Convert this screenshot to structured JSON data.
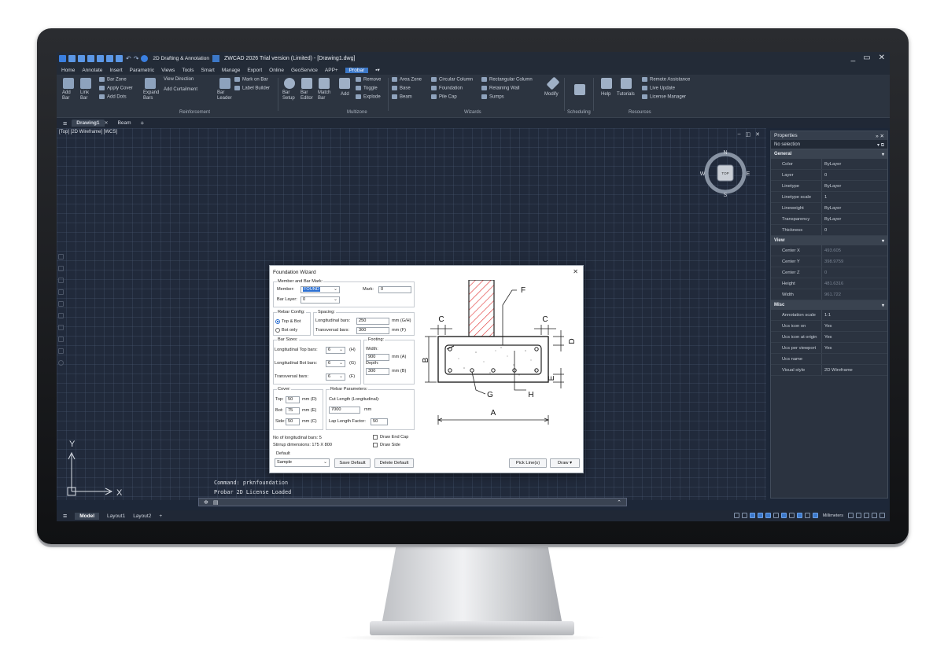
{
  "app": {
    "title": "ZWCAD 2026 Trial version (Limited) - [Drawing1.dwg]",
    "workspace": "2D Drafting & Annotation",
    "window_controls": [
      "_",
      "▭",
      "✕"
    ]
  },
  "menu": [
    "Home",
    "Annotate",
    "Insert",
    "Parametric",
    "Views",
    "Tools",
    "Smart",
    "Manage",
    "Export",
    "Online",
    "GeoService",
    "APP+",
    "Probar"
  ],
  "menu_active": "Probar",
  "ribbon": {
    "add_bar": "Add\nBar",
    "link_bar": "Link\nBar",
    "bar_zone": "Bar Zone",
    "apply_cover": "Apply Cover",
    "add_dots": "Add Dots",
    "expand_bars": "Expand\nBars",
    "view_direction": "View Direction",
    "add_curtailment": "Add Curtailment",
    "bar_leader": "Bar\nLeader",
    "mark_on_bar": "Mark on Bar",
    "label_builder": "Label Builder",
    "bar_setup": "Bar\nSetup",
    "bar_editor": "Bar\nEditor",
    "match_bar": "Match\nBar",
    "add": "Add",
    "remove": "Remove",
    "toggle": "Toggle",
    "explode": "Explode",
    "area_zone": "Area Zone",
    "base": "Base",
    "beam": "Beam",
    "circular_column": "Circular Column",
    "foundation": "Foundation",
    "pile_cap": "Pile Cap",
    "rectangular_column": "Rectangular Column",
    "retaining_wall": "Retaining Wall",
    "sumps": "Sumps",
    "modify": "Modify",
    "help": "Help",
    "tutorials": "Tutorials",
    "remote_assistance": "Remote Assistance",
    "live_update": "Live Update",
    "license_manager": "License Manager",
    "panels": [
      "Reinforcement",
      "Multizone",
      "Wizards",
      "Scheduling",
      "Resources"
    ]
  },
  "doc_tabs": [
    "Drawing1",
    "Beam"
  ],
  "view_label": "[Top] [2D Wireframe] [WCS]",
  "compass": {
    "n": "N",
    "s": "S",
    "e": "E",
    "w": "W",
    "top": "TOP"
  },
  "ucs": {
    "x": "X",
    "y": "Y"
  },
  "command": {
    "history": [
      "Command: prknfoundation",
      "Probar 2D License Loaded"
    ]
  },
  "layout_tabs": [
    "Model",
    "Layout1",
    "Layout2"
  ],
  "units": "Millimeters",
  "properties": {
    "title": "Properties",
    "selection": "No selection",
    "sections": [
      {
        "name": "General",
        "rows": [
          {
            "k": "Color",
            "v": "ByLayer"
          },
          {
            "k": "Layer",
            "v": "0"
          },
          {
            "k": "Linetype",
            "v": "ByLayer"
          },
          {
            "k": "Linetype scale",
            "v": "1"
          },
          {
            "k": "Lineweight",
            "v": "ByLayer"
          },
          {
            "k": "Transparency",
            "v": "ByLayer"
          },
          {
            "k": "Thickness",
            "v": "0"
          }
        ]
      },
      {
        "name": "View",
        "rows": [
          {
            "k": "Center X",
            "v": "493.605"
          },
          {
            "k": "Center Y",
            "v": "398.9759"
          },
          {
            "k": "Center Z",
            "v": "0"
          },
          {
            "k": "Height",
            "v": "481.6316"
          },
          {
            "k": "Width",
            "v": "961.722"
          }
        ]
      },
      {
        "name": "Misc",
        "rows": [
          {
            "k": "Annotation scale",
            "v": "1:1"
          },
          {
            "k": "Ucs icon on",
            "v": "Yes"
          },
          {
            "k": "Ucs icon at origin",
            "v": "Yes"
          },
          {
            "k": "Ucs per viewport",
            "v": "Yes"
          },
          {
            "k": "Ucs name",
            "v": ""
          },
          {
            "k": "Visual style",
            "v": "2D Wireframe"
          }
        ]
      }
    ]
  },
  "dialog": {
    "title": "Foundation Wizard",
    "member_group": "Member and Bar Mark:",
    "member_label": "Member:",
    "member_value": "FOUND",
    "mark_label": "Mark:",
    "mark_value": "0",
    "bar_layer_label": "Bar Layer:",
    "bar_layer_value": "0",
    "rebar_config_group": "Rebar Config:",
    "top_bot": "Top & Bot",
    "bot_only": "Bot only",
    "spacing_group": "Spacing:",
    "long_bars_label": "Longitudinal bars:",
    "long_bars_value": "250",
    "long_bars_unit": "mm (G/H)",
    "trans_bars_label": "Transversal bars:",
    "trans_bars_value": "300",
    "trans_bars_unit": "mm (F)",
    "bar_sizes_group": "Bar Sizes:",
    "long_top_label": "Longitudinal Top bars:",
    "long_top_value": "6",
    "long_top_tag": "(H)",
    "long_bot_label": "Longitudinal Bot bars:",
    "long_bot_value": "6",
    "long_bot_tag": "(G)",
    "trans_label": "Transversal bars:",
    "trans_value": "6",
    "trans_tag": "(F)",
    "footing_group": "Footing:",
    "width_label": "Width:",
    "width_value": "900",
    "width_unit": "mm (A)",
    "depth_label": "Depth:",
    "depth_value": "300",
    "depth_unit": "mm (B)",
    "cover_group": "Cover:",
    "top_label": "Top:",
    "top_value": "50",
    "top_unit": "mm (D)",
    "bot_label": "Bot:",
    "bot_value": "75",
    "bot_unit": "mm (E)",
    "side_label": "Side:",
    "side_value": "50",
    "side_unit": "mm (C)",
    "rebar_params_group": "Rebar Parameters:",
    "cut_length_label": "Cut Length (Longitudinal):",
    "cut_length_value": "7000",
    "cut_length_unit": "mm",
    "lap_factor_label": "Lap Length Factor:",
    "lap_factor_value": "50",
    "num_long_bars": "No of longitudinal bars:  5",
    "stirrup_dims": "Stirrup dimensions:      175 X 800",
    "draw_end_cap": "Draw End Cap",
    "draw_side": "Draw Side",
    "default_group": "Default",
    "default_value": "Sample",
    "save_default": "Save Default",
    "delete_default": "Delete Default",
    "pick_lines": "Pick Line(s)",
    "draw": "Draw",
    "diagram_labels": {
      "a": "A",
      "b": "B",
      "c": "C",
      "d": "D",
      "e": "E",
      "f": "F",
      "g": "G",
      "h": "H"
    }
  }
}
